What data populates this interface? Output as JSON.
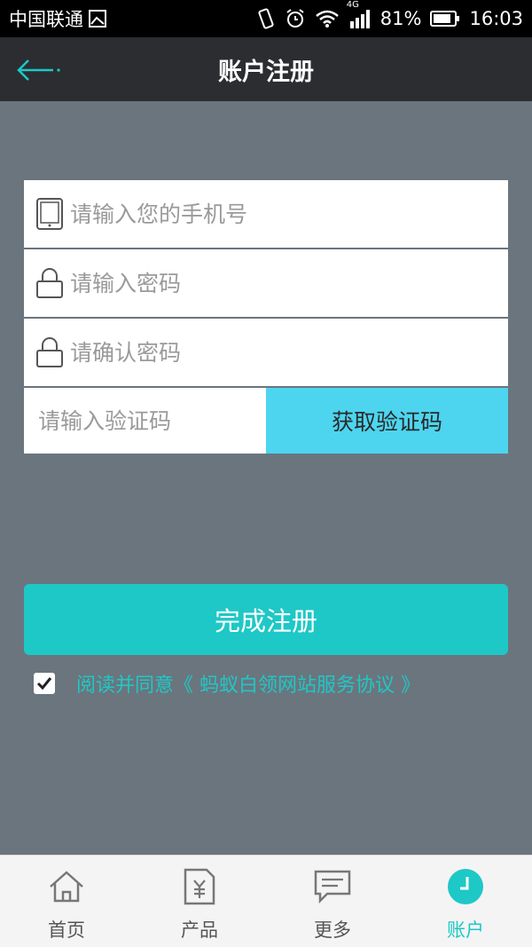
{
  "status_bar": {
    "carrier": "中国联通",
    "network": "4G",
    "battery": "81%",
    "time": "16:03"
  },
  "header": {
    "title": "账户注册"
  },
  "form": {
    "phone_placeholder": "请输入您的手机号",
    "password_placeholder": "请输入密码",
    "confirm_placeholder": "请确认密码",
    "code_placeholder": "请输入验证码",
    "get_code_label": "获取验证码"
  },
  "submit_label": "完成注册",
  "agreement": {
    "checked": true,
    "text": "阅读并同意《 蚂蚁白领网站服务协议 》"
  },
  "tabs": [
    {
      "label": "首页",
      "icon": "home-icon"
    },
    {
      "label": "产品",
      "icon": "product-icon"
    },
    {
      "label": "更多",
      "icon": "message-icon"
    },
    {
      "label": "账户",
      "icon": "account-icon",
      "active": true
    }
  ],
  "colors": {
    "accent": "#1ec8c6",
    "code_button": "#4dd5ef",
    "background": "#6b757e",
    "nav": "#2b2d31"
  }
}
